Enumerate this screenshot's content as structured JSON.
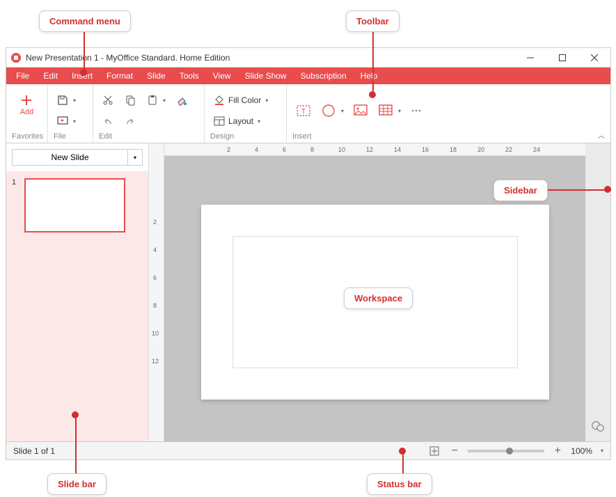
{
  "window": {
    "title": "New Presentation 1 - MyOffice Standard. Home Edition"
  },
  "menu": {
    "items": [
      "File",
      "Edit",
      "Insert",
      "Format",
      "Slide",
      "Tools",
      "View",
      "Slide Show",
      "Subscription",
      "Help"
    ]
  },
  "toolbar": {
    "favorites": {
      "label": "Favorites",
      "add": "Add"
    },
    "file": {
      "label": "File"
    },
    "edit": {
      "label": "Edit"
    },
    "design": {
      "label": "Design",
      "fillcolor": "Fill Color",
      "layout": "Layout"
    },
    "insert": {
      "label": "Insert"
    }
  },
  "slidepanel": {
    "newslide": "New Slide",
    "thumb_number": "1"
  },
  "ruler": {
    "h": [
      "2",
      "4",
      "6",
      "8",
      "10",
      "12",
      "14",
      "16",
      "18",
      "20",
      "22",
      "24"
    ],
    "v": [
      "2",
      "4",
      "6",
      "8",
      "10",
      "12"
    ]
  },
  "status": {
    "slide": "Slide 1 of 1",
    "zoom": "100%"
  },
  "callouts": {
    "command_menu": "Command menu",
    "toolbar": "Toolbar",
    "sidebar": "Sidebar",
    "workspace": "Workspace",
    "slide_bar": "Slide bar",
    "status_bar": "Status bar"
  }
}
